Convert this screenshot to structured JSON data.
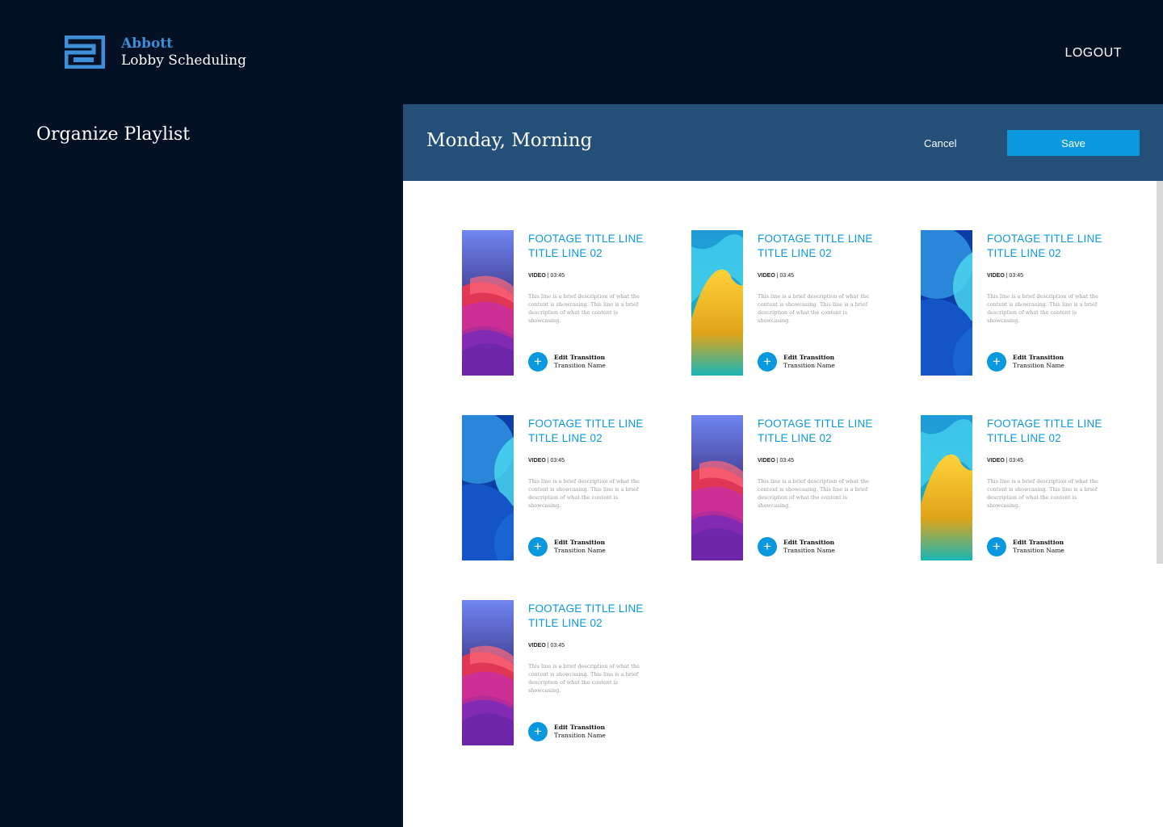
{
  "header": {
    "brand_name": "Abbott",
    "brand_sub": "Lobby Scheduling",
    "logout_label": "LOGOUT",
    "logo_color": "#3d8fd9"
  },
  "left": {
    "title": "Organize Playlist"
  },
  "panel": {
    "title": "Monday, Morning",
    "cancel_label": "Cancel",
    "save_label": "Save",
    "accent": "#0a98de",
    "header_bg": "#234f78"
  },
  "cards": [
    {
      "title_line1": "FOOTAGE TITLE LINE",
      "title_line2": "TITLE LINE 02",
      "type": "VIDEO",
      "duration": "03:45",
      "description": "This line is a brief description of what the content is showcasing. This line is a brief description of what the content is showcasing.",
      "edit_label": "Edit Transition",
      "transition_name": "Transition Name",
      "art": "pink-waves"
    },
    {
      "title_line1": "FOOTAGE TITLE LINE",
      "title_line2": "TITLE LINE 02",
      "type": "VIDEO",
      "duration": "03:45",
      "description": "This line is a brief description of what the content is showcasing. This line is a brief description of what the content is showcasing.",
      "edit_label": "Edit Transition",
      "transition_name": "Transition Name",
      "art": "yellow-wave"
    },
    {
      "title_line1": "FOOTAGE TITLE LINE",
      "title_line2": "TITLE LINE 02",
      "type": "VIDEO",
      "duration": "03:45",
      "description": "This line is a brief description of what the content is showcasing. This line is a brief description of what the content is showcasing.",
      "edit_label": "Edit Transition",
      "transition_name": "Transition Name",
      "art": "blue-circles"
    },
    {
      "title_line1": "FOOTAGE TITLE LINE",
      "title_line2": "TITLE LINE 02",
      "type": "VIDEO",
      "duration": "03:45",
      "description": "This line is a brief description of what the content is showcasing. This line is a brief description of what the content is showcasing.",
      "edit_label": "Edit Transition",
      "transition_name": "Transition Name",
      "art": "blue-circles"
    },
    {
      "title_line1": "FOOTAGE TITLE LINE",
      "title_line2": "TITLE LINE 02",
      "type": "VIDEO",
      "duration": "03:45",
      "description": "This line is a brief description of what the content is showcasing. This line is a brief description of what the content is showcasing.",
      "edit_label": "Edit Transition",
      "transition_name": "Transition Name",
      "art": "pink-waves"
    },
    {
      "title_line1": "FOOTAGE TITLE LINE",
      "title_line2": "TITLE LINE 02",
      "type": "VIDEO",
      "duration": "03:45",
      "description": "This line is a brief description of what the content is showcasing. This line is a brief description of what the content is showcasing.",
      "edit_label": "Edit Transition",
      "transition_name": "Transition Name",
      "art": "yellow-wave"
    },
    {
      "title_line1": "FOOTAGE TITLE LINE",
      "title_line2": "TITLE LINE 02",
      "type": "VIDEO",
      "duration": "03:45",
      "description": "This line is a brief description of what the content is showcasing. This line is a brief description of what the content is showcasing.",
      "edit_label": "Edit Transition",
      "transition_name": "Transition Name",
      "art": "pink-waves"
    }
  ]
}
